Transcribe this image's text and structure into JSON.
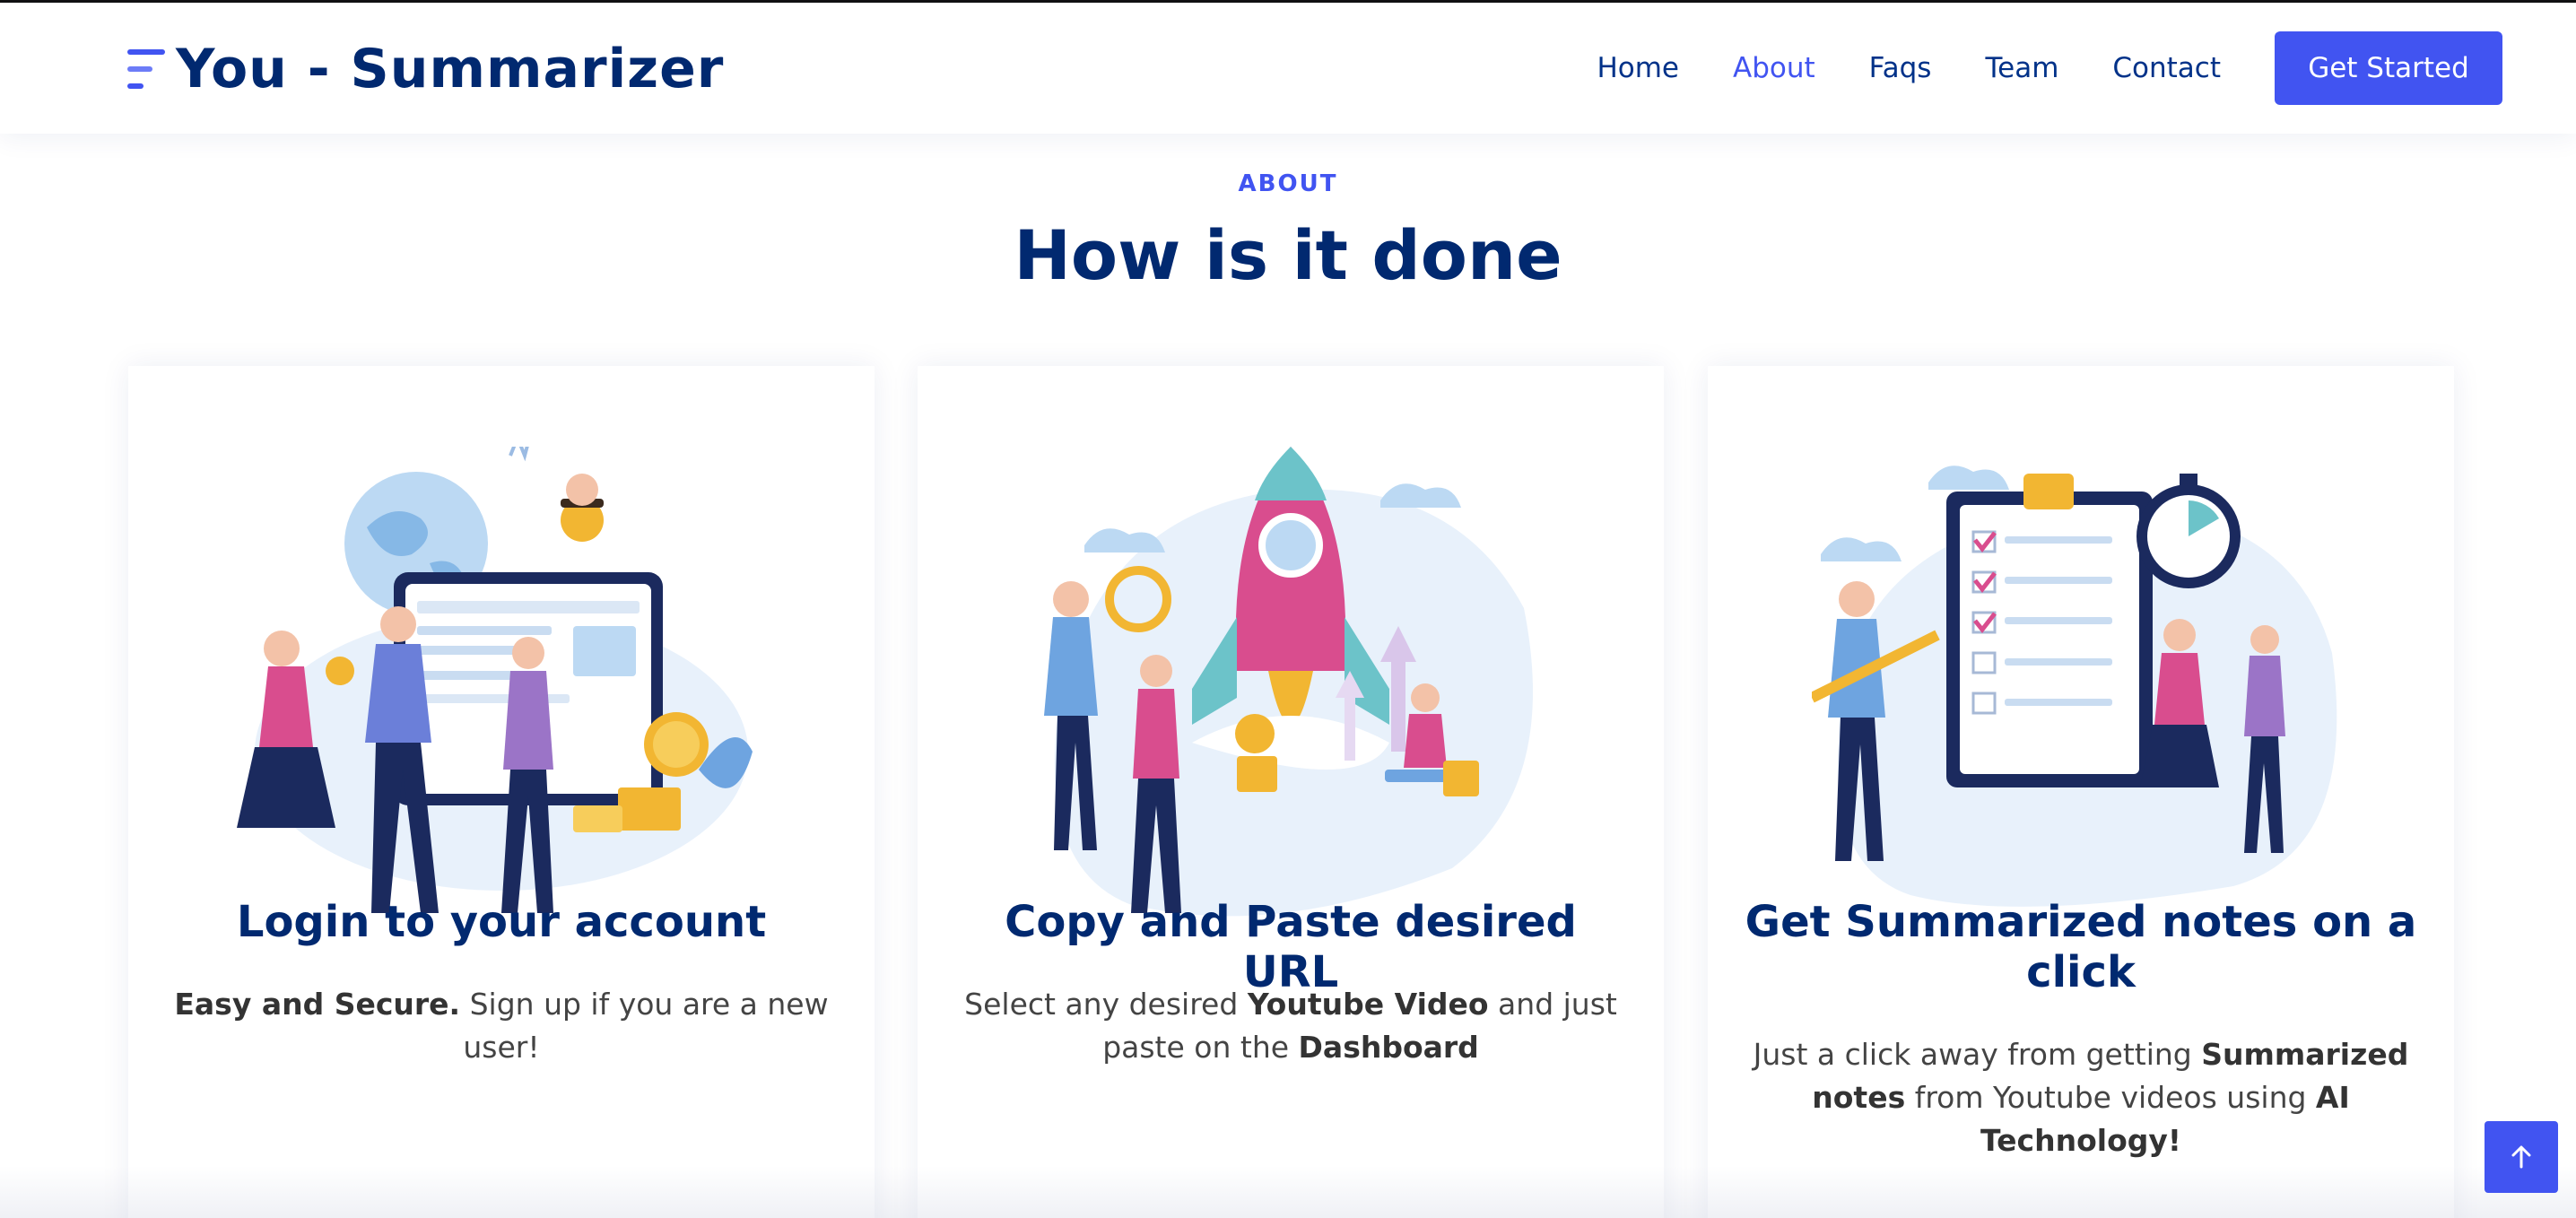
{
  "app": {
    "title": "You - Summarizer"
  },
  "nav": {
    "items": [
      {
        "label": "Home",
        "active": false
      },
      {
        "label": "About",
        "active": true
      },
      {
        "label": "Faqs",
        "active": false
      },
      {
        "label": "Team",
        "active": false
      },
      {
        "label": "Contact",
        "active": false
      }
    ],
    "cta_label": "Get Started"
  },
  "about": {
    "eyebrow": "ABOUT",
    "title": "How is it done",
    "cards": [
      {
        "title": "Login to your account",
        "desc": [
          {
            "bold": "Easy and Secure."
          },
          {
            "text": " Sign up if you are a new user!"
          }
        ]
      },
      {
        "title": "Copy and Paste desired URL",
        "desc": [
          {
            "text": "Select any desired "
          },
          {
            "bold": "Youtube Video"
          },
          {
            "text": " and just paste on the "
          },
          {
            "bold": "Dashboard"
          }
        ]
      },
      {
        "title": "Get Summarized notes on a click",
        "desc": [
          {
            "text": "Just a click away from getting "
          },
          {
            "bold": "Summarized notes"
          },
          {
            "text": " from Youtube videos using "
          },
          {
            "bold": "AI Technology!"
          }
        ]
      }
    ]
  },
  "icons": {
    "logo": "menu-lines-icon",
    "back_to_top": "arrow-up-icon"
  },
  "colors": {
    "primary": "#4154f1",
    "heading": "#012970",
    "nav_text": "#013289",
    "body_text": "#444444"
  }
}
